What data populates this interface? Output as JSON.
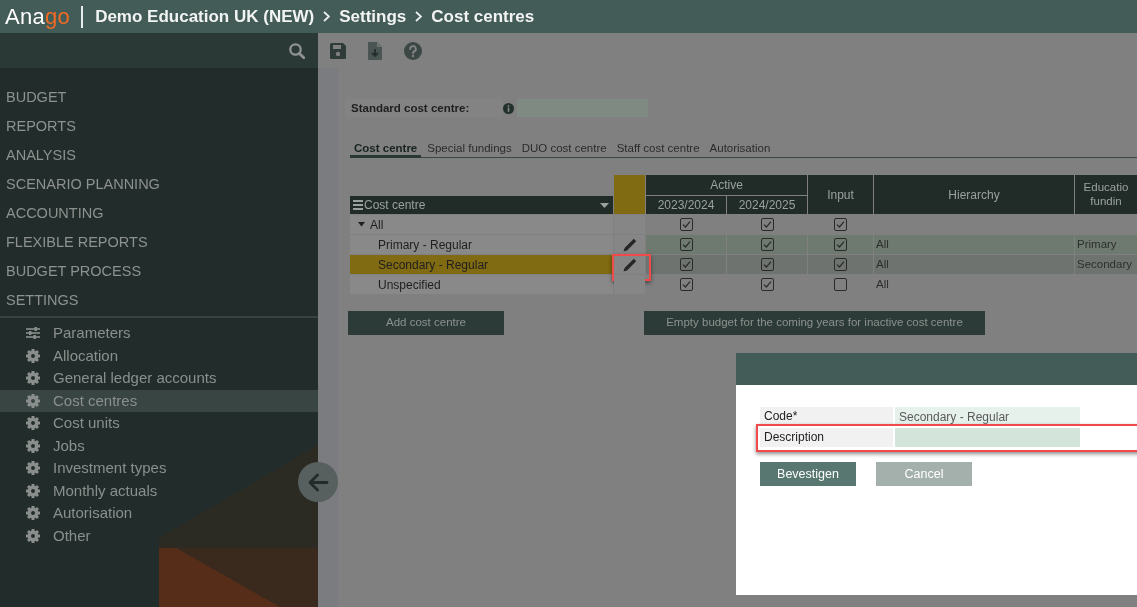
{
  "header": {
    "logo": {
      "lead": "Ana",
      "accent": "go"
    },
    "breadcrumb": [
      "Demo Education UK (NEW)",
      "Settings",
      "Cost centres"
    ]
  },
  "sidebar": {
    "sections": [
      {
        "label": "BUDGET"
      },
      {
        "label": "REPORTS"
      },
      {
        "label": "ANALYSIS"
      },
      {
        "label": "SCENARIO PLANNING"
      },
      {
        "label": "ACCOUNTING"
      },
      {
        "label": "FLEXIBLE REPORTS"
      },
      {
        "label": "BUDGET PROCESS"
      },
      {
        "label": "SETTINGS",
        "children": [
          {
            "label": "Parameters",
            "kind": "parameters",
            "selected": false
          },
          {
            "label": "Allocation",
            "kind": "setting",
            "selected": false
          },
          {
            "label": "General ledger accounts",
            "kind": "setting",
            "selected": false
          },
          {
            "label": "Cost centres",
            "kind": "setting",
            "selected": true
          },
          {
            "label": "Cost units",
            "kind": "setting",
            "selected": false
          },
          {
            "label": "Jobs",
            "kind": "setting",
            "selected": false
          },
          {
            "label": "Investment types",
            "kind": "setting",
            "selected": false
          },
          {
            "label": "Monthly actuals",
            "kind": "setting",
            "selected": false
          },
          {
            "label": "Autorisation",
            "kind": "setting",
            "selected": false
          },
          {
            "label": "Other",
            "kind": "setting",
            "selected": false
          }
        ]
      }
    ]
  },
  "standard_cost_centre": {
    "label": "Standard cost centre:"
  },
  "tabs": [
    {
      "label": "Cost centre",
      "selected": true
    },
    {
      "label": "Special fundings",
      "selected": false
    },
    {
      "label": "DUO cost centre",
      "selected": false
    },
    {
      "label": "Staff cost centre",
      "selected": false
    },
    {
      "label": "Autorisation",
      "selected": false
    }
  ],
  "grid": {
    "columns": [
      {
        "label": "Cost centre"
      },
      {
        "label": "Active",
        "children": [
          {
            "label": "2023/2024"
          },
          {
            "label": "2024/2025"
          }
        ]
      },
      {
        "label": "Input"
      },
      {
        "label": "Hierarchy"
      },
      {
        "label": "Educatio\nfundin"
      }
    ],
    "rows": [
      {
        "name": "All",
        "expanded": true,
        "selected": false,
        "hovered": false,
        "editable": false,
        "callout": false,
        "active": [
          true,
          true
        ],
        "input": true,
        "children": [
          {
            "name": "Primary - Regular",
            "selected": false,
            "hovered": true,
            "editable": true,
            "callout": false,
            "active": [
              true,
              true
            ],
            "input": true,
            "hierarchy": "All",
            "funding": "Primary"
          },
          {
            "name": "Secondary - Regular",
            "selected": true,
            "hovered": false,
            "editable": true,
            "callout": true,
            "active": [
              true,
              true
            ],
            "input": true,
            "hierarchy": "All",
            "funding": "Secondary"
          },
          {
            "name": "Unspecified",
            "selected": false,
            "hovered": false,
            "editable": false,
            "callout": false,
            "active": [
              true,
              true
            ],
            "input": false,
            "hierarchy": "All"
          }
        ]
      }
    ]
  },
  "buttons": [
    {
      "label": "Add cost centre"
    },
    {
      "label": "Empty budget for the coming years for inactive cost centre"
    }
  ],
  "dialog": {
    "fields": [
      {
        "label": "Code*",
        "value": "Secondary - Regular",
        "callout": false
      },
      {
        "label": "Description",
        "callout": true
      }
    ],
    "buttons": [
      {
        "label": "Bevestigen",
        "kind": "primary"
      },
      {
        "label": "Cancel",
        "kind": "secondary"
      }
    ]
  }
}
